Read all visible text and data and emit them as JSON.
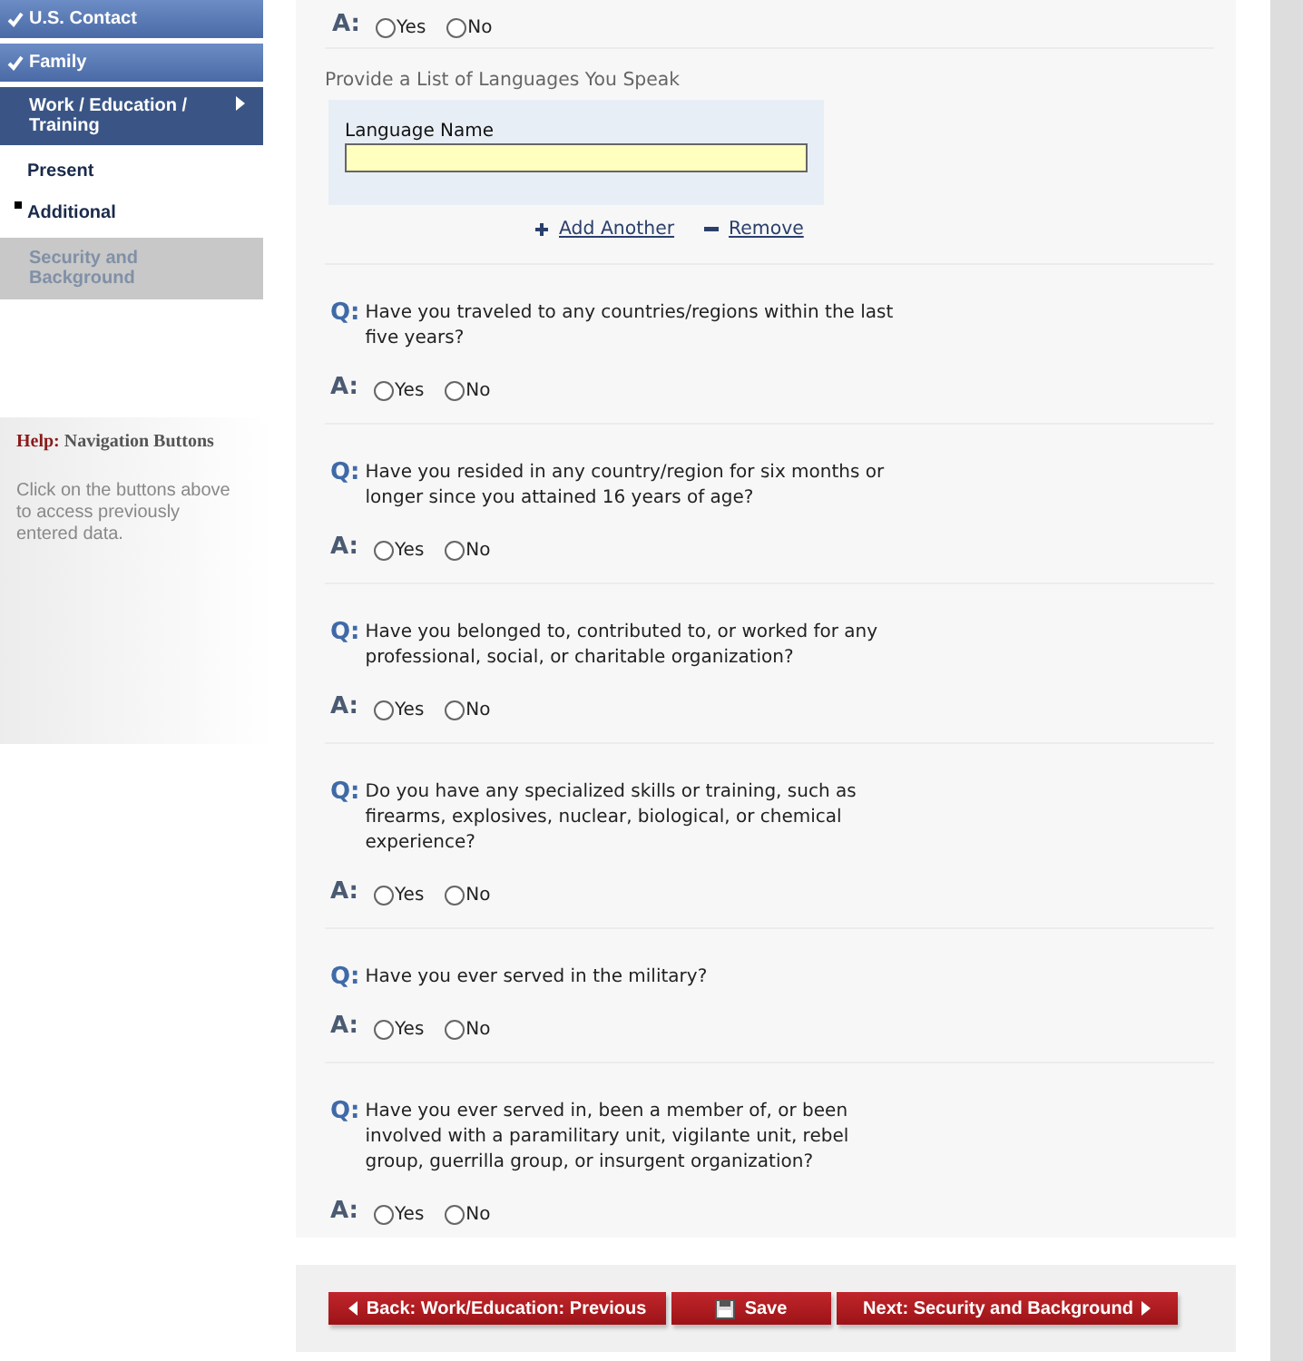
{
  "sidebar": {
    "items": [
      {
        "label": "U.S. Contact",
        "kind": "done"
      },
      {
        "label": "Family",
        "kind": "done"
      },
      {
        "label": "Work / Education / Training",
        "kind": "current",
        "children": [
          {
            "label": "Present",
            "selected": false
          },
          {
            "label": "Additional",
            "selected": true
          }
        ]
      },
      {
        "label": "Security and Background",
        "kind": "locked"
      }
    ]
  },
  "help": {
    "label": "Help:",
    "title": "Navigation Buttons",
    "text": "Click on the buttons above to access previously entered data."
  },
  "form": {
    "top_answer": {
      "a_label": "A:",
      "options": [
        {
          "label": "Yes",
          "selected": false
        },
        {
          "label": "No",
          "selected": false
        }
      ]
    },
    "languages": {
      "label": "Provide a List of Languages You Speak",
      "column": "Language Name",
      "add": "Add Another",
      "remove": "Remove"
    },
    "questions": [
      {
        "q_label": "Q:",
        "text": "Have you traveled to any countries/regions within the last five years?",
        "a_label": "A:",
        "options": [
          {
            "label": "Yes",
            "selected": false
          },
          {
            "label": "No",
            "selected": false
          }
        ]
      },
      {
        "q_label": "Q:",
        "text": "Have you resided in any country/region for six months or longer since you attained 16 years of age?",
        "a_label": "A:",
        "options": [
          {
            "label": "Yes",
            "selected": false
          },
          {
            "label": "No",
            "selected": false
          }
        ]
      },
      {
        "q_label": "Q:",
        "text": "Have you belonged to, contributed to, or worked for any professional, social, or charitable organization?",
        "a_label": "A:",
        "options": [
          {
            "label": "Yes",
            "selected": false
          },
          {
            "label": "No",
            "selected": false
          }
        ]
      },
      {
        "q_label": "Q:",
        "text": "Do you have any specialized skills or training, such as firearms, explosives, nuclear, biological, or chemical experience?",
        "a_label": "A:",
        "options": [
          {
            "label": "Yes",
            "selected": false
          },
          {
            "label": "No",
            "selected": false
          }
        ]
      },
      {
        "q_label": "Q:",
        "text": "Have you ever served in the military?",
        "a_label": "A:",
        "options": [
          {
            "label": "Yes",
            "selected": false
          },
          {
            "label": "No",
            "selected": false
          }
        ]
      },
      {
        "q_label": "Q:",
        "text": "Have you ever served in, been a member of, or been involved with a paramilitary unit, vigilante unit, rebel group, guerrilla group, or insurgent organization?",
        "a_label": "A:",
        "options": [
          {
            "label": "Yes",
            "selected": false
          },
          {
            "label": "No",
            "selected": false
          }
        ]
      }
    ]
  },
  "nav_buttons": [
    {
      "label": "Back: Work/Education: Previous",
      "kind": "back"
    },
    {
      "label": "Save",
      "kind": "save"
    },
    {
      "label": "Next: Security and Background",
      "kind": "next"
    }
  ]
}
